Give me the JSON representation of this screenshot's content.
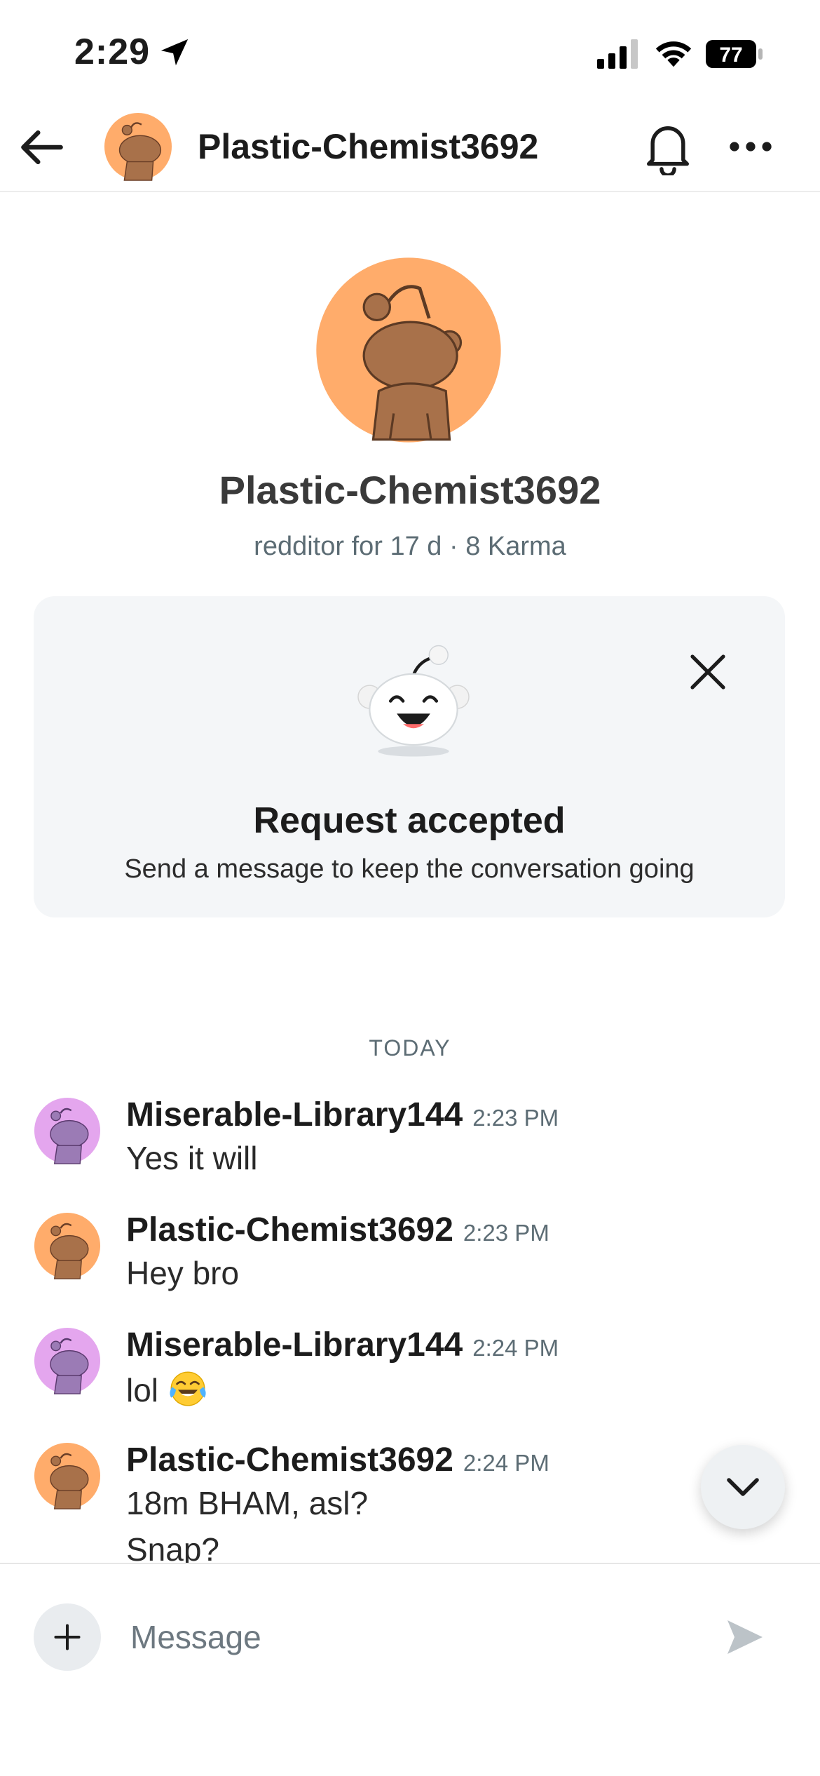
{
  "status_bar": {
    "time": "2:29",
    "battery": "77"
  },
  "header": {
    "title": "Plastic-Chemist3692"
  },
  "profile": {
    "username": "Plastic-Chemist3692",
    "meta": "redditor for 17 d · 8 Karma"
  },
  "request_card": {
    "title": "Request accepted",
    "subtitle": "Send a message to keep the conversation going"
  },
  "divider": {
    "label": "TODAY"
  },
  "messages": [
    {
      "author": "Miserable-Library144",
      "time": "2:23 PM",
      "text": "Yes it will",
      "avatar_color": "#e4a6ee"
    },
    {
      "author": "Plastic-Chemist3692",
      "time": "2:23 PM",
      "text": "Hey bro",
      "avatar_color": "#ffac6b"
    },
    {
      "author": "Miserable-Library144",
      "time": "2:24 PM",
      "text": "lol",
      "emoji": "face-with-tears-of-joy",
      "avatar_color": "#e4a6ee"
    },
    {
      "author": "Plastic-Chemist3692",
      "time": "2:24 PM",
      "text": "18m BHAM, asl?",
      "text2": "Snap?",
      "avatar_color": "#ffac6b"
    }
  ],
  "composer": {
    "placeholder": "Message"
  },
  "colors": {
    "orange_avatar": "#ffac6b",
    "purple_avatar": "#e4a6ee",
    "card_bg": "#f4f6f8",
    "muted_text": "#5c6c74"
  },
  "icons": {
    "back": "arrow-left-icon",
    "notifications": "bell-icon",
    "more": "more-horizontal-icon",
    "close": "close-icon",
    "scroll_down": "chevron-down-icon",
    "add": "plus-icon",
    "send": "send-icon"
  }
}
